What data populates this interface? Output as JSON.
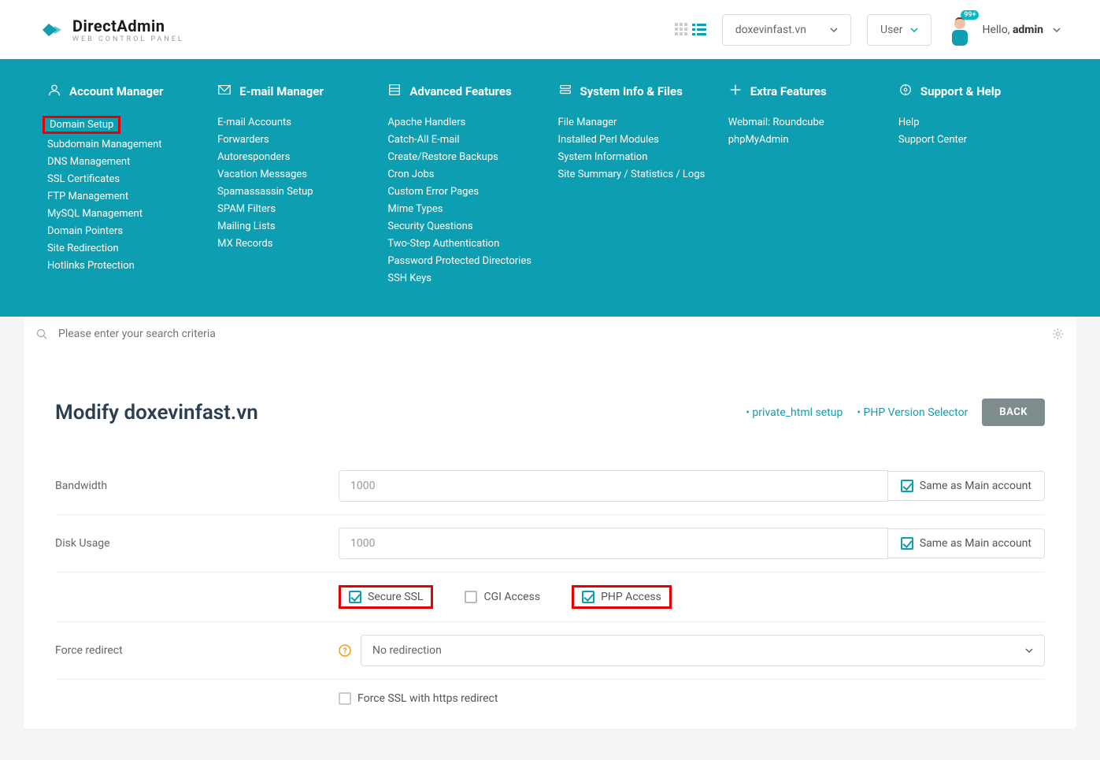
{
  "header": {
    "brand": "DirectAdmin",
    "brand_sub": "web control panel",
    "domain_select": "doxevinfast.vn",
    "role_select": "User",
    "badge": "99+",
    "hello_prefix": "Hello,",
    "hello_user": "admin"
  },
  "nav": {
    "cols": [
      {
        "title": "Account Manager",
        "items": [
          "Domain Setup",
          "Subdomain Management",
          "DNS Management",
          "SSL Certificates",
          "FTP Management",
          "MySQL Management",
          "Domain Pointers",
          "Site Redirection",
          "Hotlinks Protection"
        ],
        "boxed": 0
      },
      {
        "title": "E-mail Manager",
        "items": [
          "E-mail Accounts",
          "Forwarders",
          "Autoresponders",
          "Vacation Messages",
          "Spamassassin Setup",
          "SPAM Filters",
          "Mailing Lists",
          "MX Records"
        ]
      },
      {
        "title": "Advanced Features",
        "items": [
          "Apache Handlers",
          "Catch-All E-mail",
          "Create/Restore Backups",
          "Cron Jobs",
          "Custom Error Pages",
          "Mime Types",
          "Security Questions",
          "Two-Step Authentication",
          "Password Protected Directories",
          "SSH Keys"
        ]
      },
      {
        "title": "System Info & Files",
        "items": [
          "File Manager",
          "Installed Perl Modules",
          "System Information",
          "Site Summary / Statistics / Logs"
        ]
      },
      {
        "title": "Extra Features",
        "items": [
          "Webmail: Roundcube",
          "phpMyAdmin"
        ]
      },
      {
        "title": "Support & Help",
        "items": [
          "Help",
          "Support Center"
        ]
      }
    ]
  },
  "search": {
    "placeholder": "Please enter your search criteria"
  },
  "page": {
    "title": "Modify doxevinfast.vn",
    "link1": "• private_html setup",
    "link2": "• PHP Version Selector",
    "back": "BACK",
    "bandwidth_label": "Bandwidth",
    "bandwidth_value": "1000",
    "disk_label": "Disk Usage",
    "disk_value": "1000",
    "same_label": "Same as Main account",
    "ssl": "Secure SSL",
    "cgi": "CGI Access",
    "php": "PHP Access",
    "redirect_label": "Force redirect",
    "redirect_value": "No redirection",
    "force_ssl": "Force SSL with https redirect"
  }
}
